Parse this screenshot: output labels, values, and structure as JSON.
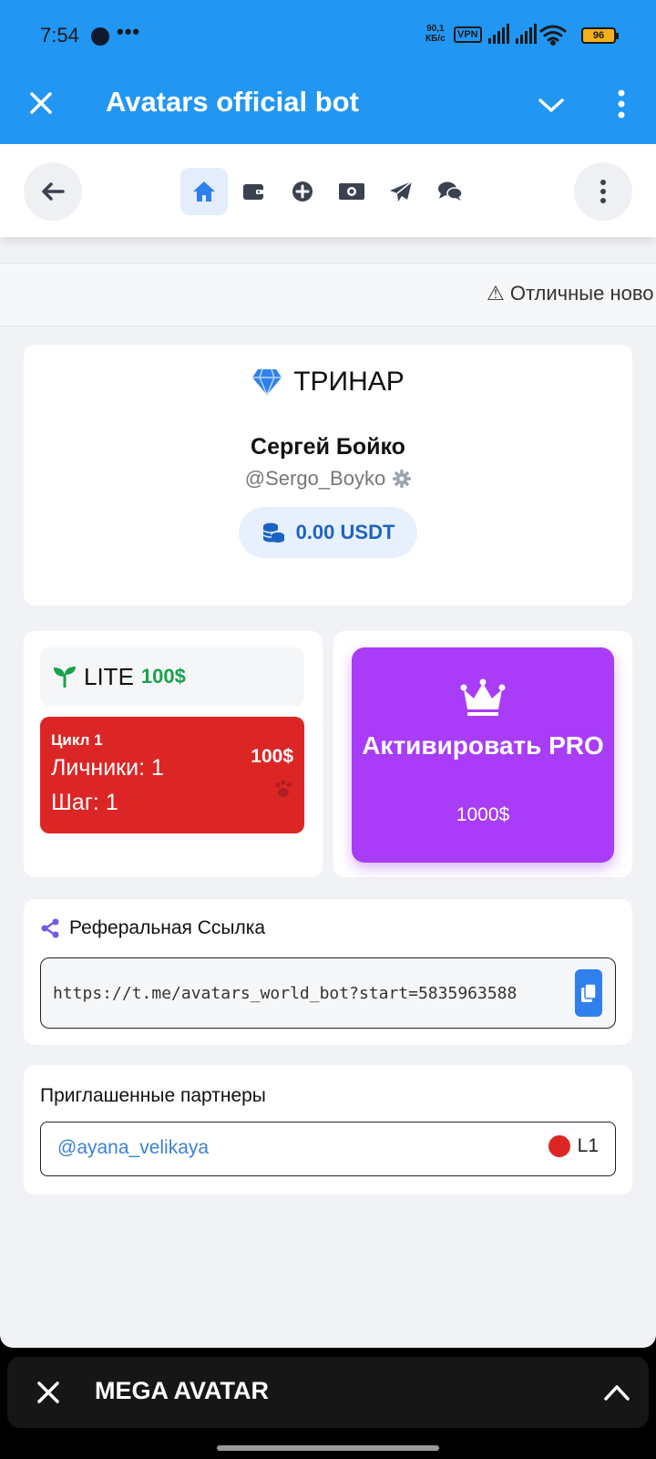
{
  "status_bar": {
    "time": "7:54",
    "more": "•••",
    "net_speed_value": "90,1",
    "net_speed_unit": "КБ/с",
    "vpn": "VPN",
    "battery": "96"
  },
  "header": {
    "title": "Avatars official bot"
  },
  "nav": {
    "tabs": [
      "home-icon",
      "wallet-icon",
      "plus-circle-icon",
      "money-icon",
      "send-icon",
      "chat-icon"
    ],
    "active_tab": "home"
  },
  "ticker": {
    "text": "⚠ Отличные ново"
  },
  "profile": {
    "rank": "ТРИНАР",
    "name": "Сергей Бойко",
    "handle": "@Sergo_Boyko",
    "balance": "0.00 USDT"
  },
  "lite": {
    "name": "LITE",
    "price": "100$",
    "cycle_title": "Цикл 1",
    "personal": "Личники: 1",
    "step": "Шаг: 1",
    "amount": "100$"
  },
  "pro": {
    "label": "Активировать PRO",
    "price": "1000$"
  },
  "referral": {
    "title": "Реферальная Ссылка",
    "link": "https://t.me/avatars_world_bot?start=5835963588"
  },
  "partners": {
    "title": "Приглашенные партнеры",
    "items": [
      {
        "username": "@ayana_velikaya",
        "level": "L1",
        "level_color": "#dc2626"
      }
    ]
  },
  "mini_app_bar": {
    "title": "MEGA AVATAR"
  },
  "colors": {
    "telegram_blue": "#2196f3",
    "accent_blue": "#1e63c4",
    "pro_purple": "#a83cf7",
    "cycle_red": "#dc2626",
    "lite_green": "#16a34a"
  }
}
